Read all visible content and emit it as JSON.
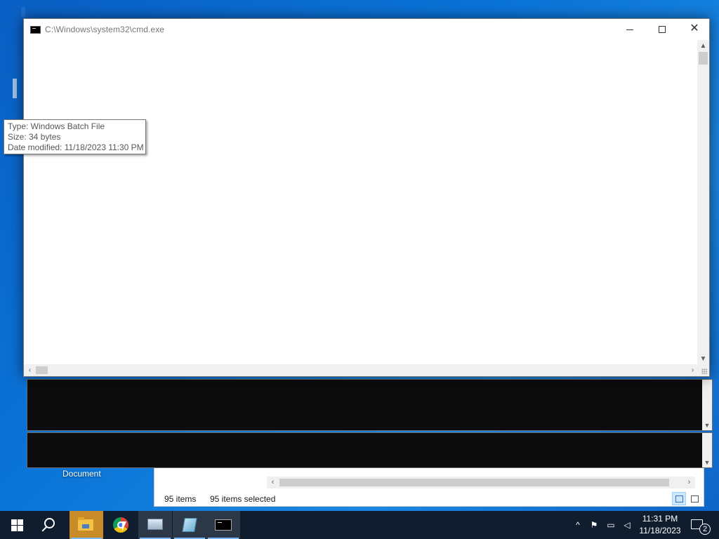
{
  "cmd_window": {
    "title": "C:\\Windows\\system32\\cmd.exe"
  },
  "tooltip": {
    "type_line": "Type: Windows Batch File",
    "size_line": "Size: 34 bytes",
    "modified_line": "Date modified: 11/18/2023 11:30 PM"
  },
  "explorer": {
    "item_count": "95 items",
    "selected_count": "95 items selected",
    "folder_partial_label": "Document"
  },
  "taskbar": {
    "apps": [
      {
        "name": "start",
        "icon": "windows-logo-icon"
      },
      {
        "name": "search",
        "icon": "search-icon"
      },
      {
        "name": "file-explorer",
        "icon": "folder-icon"
      },
      {
        "name": "chrome",
        "icon": "chrome-icon"
      },
      {
        "name": "server-manager",
        "icon": "monitor-icon"
      },
      {
        "name": "notepad",
        "icon": "document-icon"
      },
      {
        "name": "command-prompt",
        "icon": "cmd-icon"
      }
    ],
    "clock_time": "11:31 PM",
    "clock_date": "11/18/2023",
    "notification_count": "2"
  },
  "colors": {
    "taskbar": "#0f1d2e",
    "desktop": "#0a6fd6",
    "console": "#0c0c0c",
    "active_indicator": "#79b8f3"
  }
}
